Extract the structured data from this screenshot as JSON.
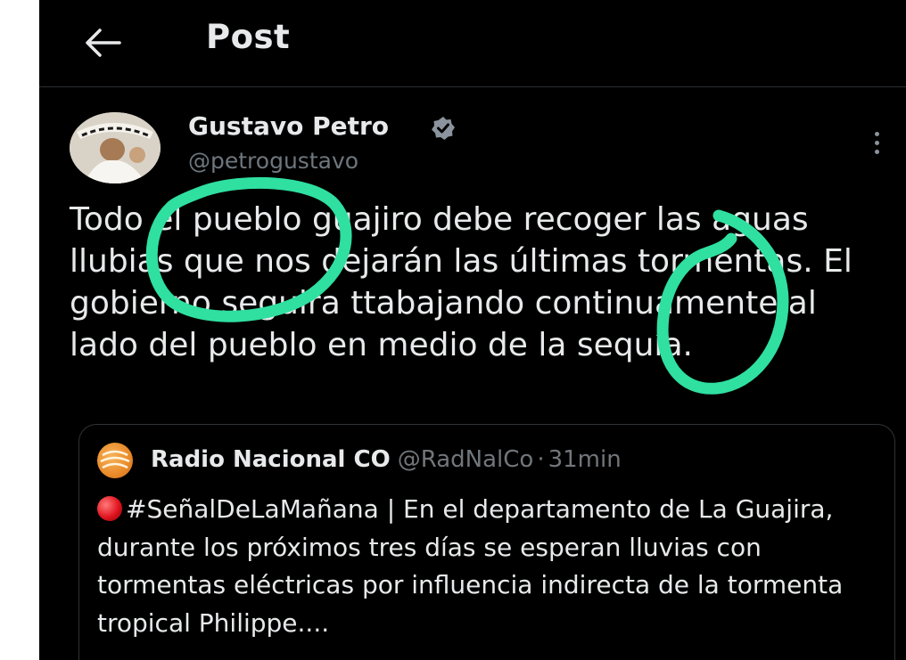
{
  "header": {
    "back_icon": "arrow-left-icon",
    "title": "Post"
  },
  "post": {
    "author_name": "Gustavo Petro",
    "verified_icon": "verified-badge-icon",
    "author_handle": "@petrogustavo",
    "more_icon": "more-vertical-icon",
    "text": "Todo el pueblo guajiro debe recoger las aguas llubias que nos dejarán las últimas tormentas. El gobierno seguira ttabajando continuamente al lado del pueblo en medio de la sequía."
  },
  "quoted_post": {
    "author_name": "Radio Nacional CO",
    "author_handle": "@RadNalCo",
    "separator": "·",
    "time": "31min",
    "emoji_icon": "red-circle-icon",
    "text": "#SeñalDeLaMañana | En el departamento de La Guajira, durante los próximos tres días se esperan lluvias con tormentas eléctricas por influencia indirecta de la tormenta tropical Philippe...."
  },
  "colors": {
    "background": "#000000",
    "text_primary": "#e7e9ea",
    "text_secondary": "#6e767d",
    "verified_badge": "#8b949e",
    "annotation_marker": "#2fe0a0"
  }
}
